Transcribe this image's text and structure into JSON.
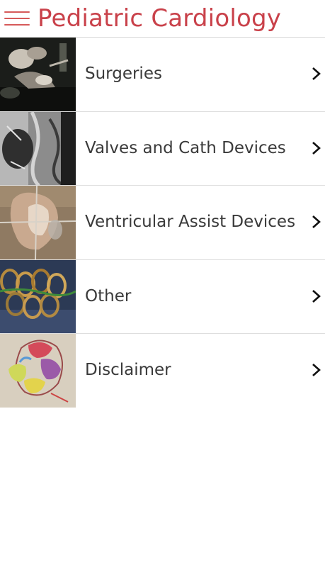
{
  "header": {
    "title": "Pediatric Cardiology",
    "menu_icon": "hamburger-menu-icon",
    "title_color": "#c9414a"
  },
  "menu": {
    "items": [
      {
        "label": "Surgeries",
        "thumbnail": "surgery-photo",
        "icon": "chevron-right-icon"
      },
      {
        "label": "Valves and Cath Devices",
        "thumbnail": "angiogram-xray-photo",
        "icon": "chevron-right-icon"
      },
      {
        "label": "Ventricular Assist Devices",
        "thumbnail": "heart-model-photo",
        "icon": "chevron-right-icon"
      },
      {
        "label": "Other",
        "thumbnail": "wire-coils-photo",
        "icon": "chevron-right-icon"
      },
      {
        "label": "Disclaimer",
        "thumbnail": "heart-sketch-photo",
        "icon": "chevron-right-icon"
      }
    ]
  }
}
